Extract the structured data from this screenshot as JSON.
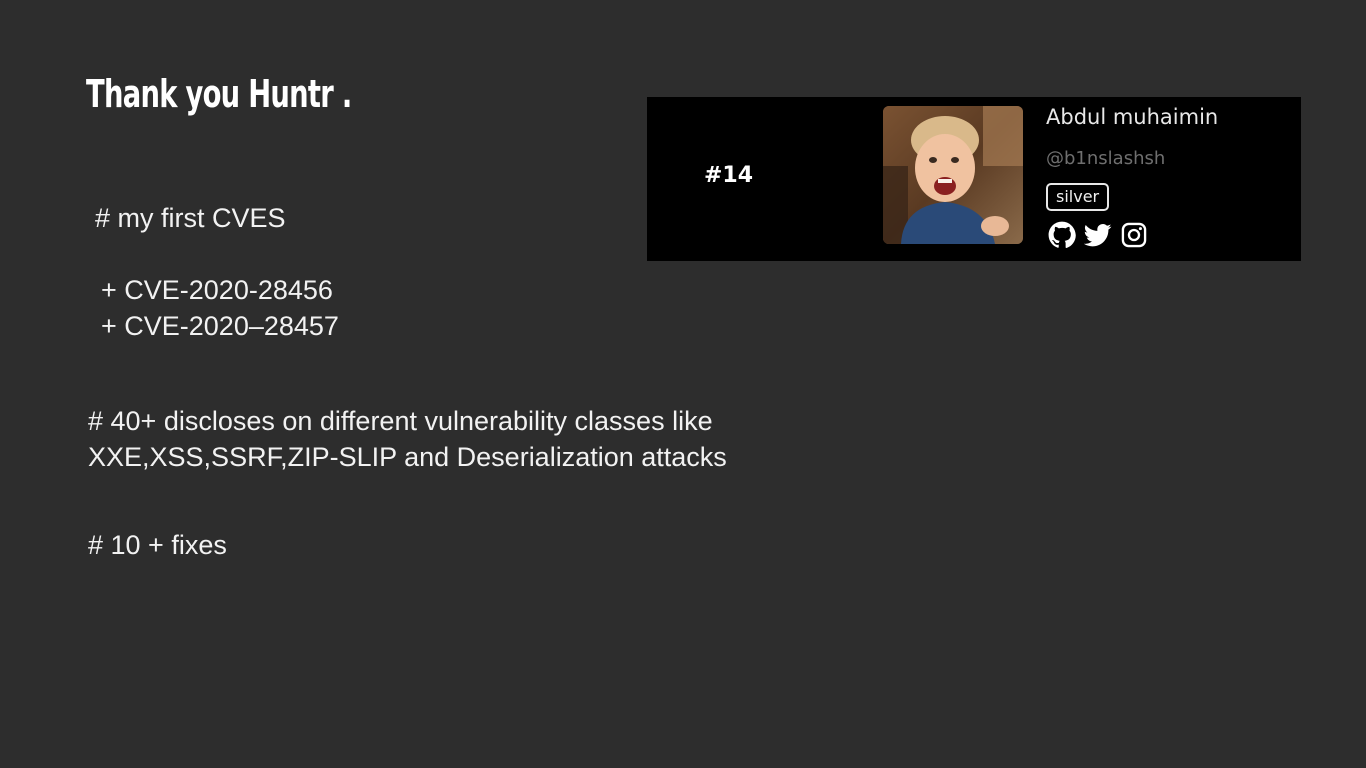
{
  "slide": {
    "title": "Thank you Huntr .",
    "lines": [
      "# my first CVES",
      "+ CVE-2020-28456",
      "+ CVE-2020–28457",
      "# 40+ discloses on different vulnerability classes like",
      "XXE,XSS,SSRF,ZIP-SLIP and Deserialization attacks",
      "# 10 + fixes"
    ]
  },
  "profile_card": {
    "rank": "#14",
    "name": "Abdul muhaimin",
    "handle": "@b1nslashsh",
    "badge": "silver",
    "icons": [
      "github-icon",
      "twitter-icon",
      "instagram-icon"
    ],
    "colors": {
      "background": "#000000",
      "text": "#e8e8e8",
      "handle": "#6f6f6f"
    }
  },
  "colors": {
    "background": "#2d2d2d",
    "text": "#f2f2f2"
  }
}
